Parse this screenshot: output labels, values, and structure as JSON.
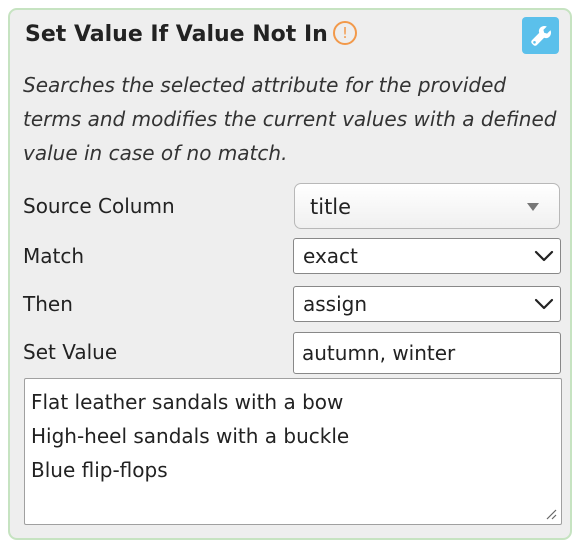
{
  "node": {
    "title": "Set Value If Value Not In",
    "warning_icon": "exclamation-circle-icon",
    "warning_glyph": "!",
    "settings_icon": "wrench-icon",
    "description": "Searches the selected attribute for the provided terms and modifies the current values with a defined value in case of no match.",
    "accent_color": "#5bc0eb",
    "warning_color": "#f2994a",
    "border_color": "#c6e3c1"
  },
  "fields": {
    "source_column": {
      "label": "Source Column",
      "value": "title"
    },
    "match": {
      "label": "Match",
      "value": "exact"
    },
    "then": {
      "label": "Then",
      "value": "assign"
    },
    "set_value": {
      "label": "Set Value",
      "value": "autumn, winter"
    }
  },
  "terms": [
    "Flat leather sandals with a bow",
    "High-heel sandals with a buckle",
    "Blue flip-flops"
  ]
}
